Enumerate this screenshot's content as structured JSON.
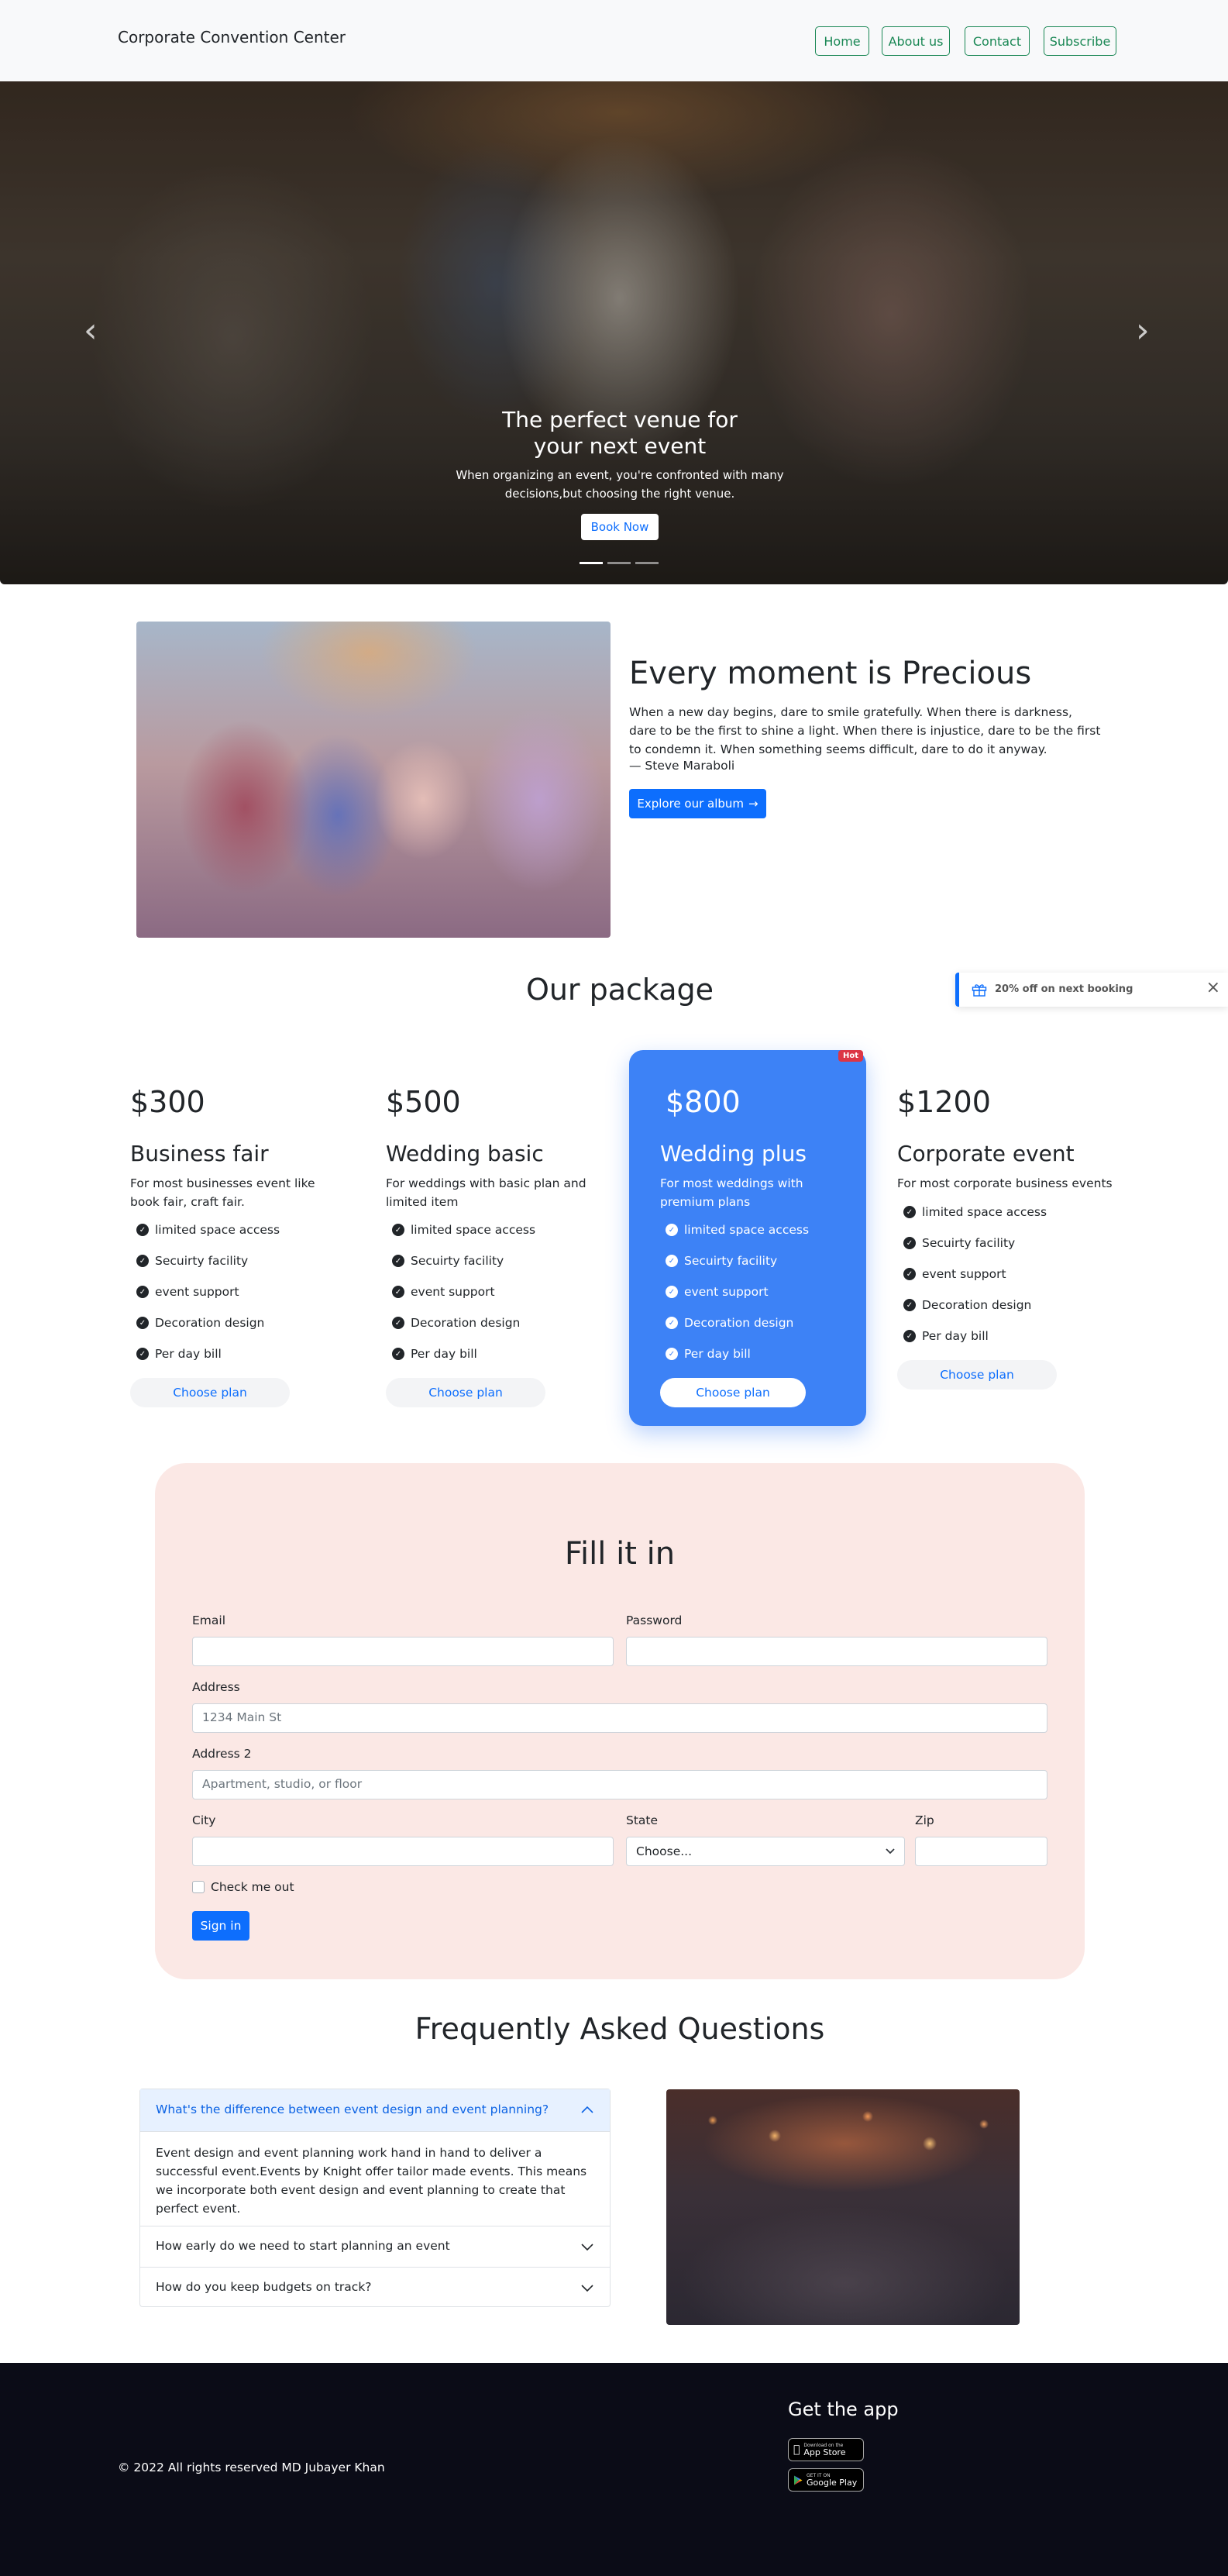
{
  "navbar": {
    "brand": "Corporate Convention Center",
    "links": [
      "Home",
      "About us",
      "Contact",
      "Subscribe"
    ]
  },
  "hero": {
    "title": "The perfect venue for your next event",
    "subtitle": "When organizing an event, you're confronted with many decisions,but choosing the right venue.",
    "button": "Book Now",
    "prev_icon": "chevron-left-icon",
    "next_icon": "chevron-right-icon",
    "slides": 3,
    "active_slide": 1
  },
  "about": {
    "title": "Every moment is Precious",
    "quote": "When a new day begins, dare to smile gratefully. When there is darkness, dare to be the first to shine a light. When there is injustice, dare to be the first to condemn it. When something seems difficult, dare to do it anyway.",
    "author": "— Steve Maraboli",
    "button": "Explore our album",
    "button_icon": "arrow-right-icon"
  },
  "toast": {
    "icon": "gift-icon",
    "text": "20% off on next booking",
    "close_icon": "close-icon"
  },
  "packages": {
    "title": "Our package",
    "plans": [
      {
        "price": "$300",
        "name": "Business fair",
        "desc": "For most businesses event like book fair, craft fair.",
        "features": [
          "limited space access",
          "Secuirty facility",
          "event support",
          "Decoration design",
          "Per day bill"
        ],
        "button": "Choose plan"
      },
      {
        "price": "$500",
        "name": "Wedding basic",
        "desc": "For weddings with basic plan and limited item",
        "features": [
          "limited space access",
          "Secuirty facility",
          "event support",
          "Decoration design",
          "Per day bill"
        ],
        "button": "Choose plan"
      },
      {
        "price": "$800",
        "name": "Wedding plus",
        "desc": "For most weddings with premium plans",
        "features": [
          "limited space access",
          "Secuirty facility",
          "event support",
          "Decoration design",
          "Per day bill"
        ],
        "button": "Choose plan",
        "badge": "Hot"
      },
      {
        "price": "$1200",
        "name": "Corporate event",
        "desc": "For most corporate business events",
        "features": [
          "limited space access",
          "Secuirty facility",
          "event support",
          "Decoration design",
          "Per day bill"
        ],
        "button": "Choose plan"
      }
    ],
    "accent": "#3d82f6"
  },
  "form": {
    "title": "Fill it in",
    "email_label": "Email",
    "password_label": "Password",
    "address_label": "Address",
    "address_placeholder": "1234 Main St",
    "address2_label": "Address 2",
    "address2_placeholder": "Apartment, studio, or floor",
    "city_label": "City",
    "state_label": "State",
    "state_value": "Choose...",
    "zip_label": "Zip",
    "checkbox_label": "Check me out",
    "submit": "Sign in",
    "background": "#fbe8e5"
  },
  "faq": {
    "title": "Frequently Asked Questions",
    "items": [
      {
        "question": "What's the difference between event design and event planning?",
        "answer": "Event design and event planning work hand in hand to deliver a successful event.Events by Knight offer tailor made events. This means we incorporate both event design and event planning to create that perfect event.",
        "expanded": true
      },
      {
        "question": "How early do we need to start planning an event",
        "expanded": false
      },
      {
        "question": "How do you keep budgets on track?",
        "expanded": false
      }
    ]
  },
  "footer": {
    "copyright": "© 2022 All rights reserved MD Jubayer Khan",
    "app_title": "Get the app",
    "app_store_small": "Download on the",
    "app_store": "App Store",
    "google_small": "GET IT ON",
    "google": "Google Play"
  }
}
